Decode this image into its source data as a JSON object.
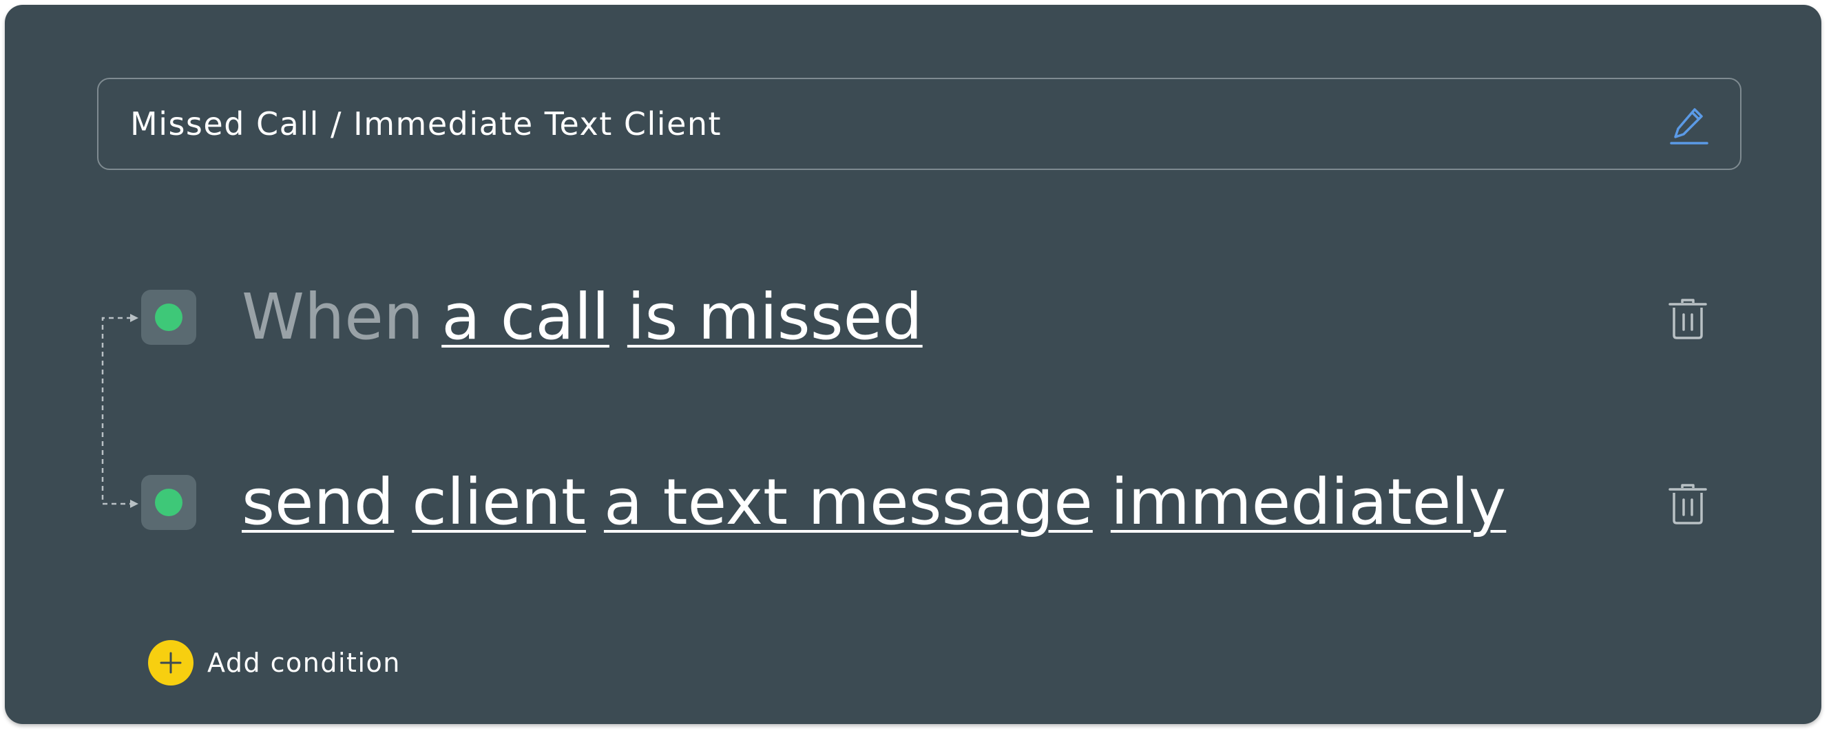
{
  "automation": {
    "name": "Missed Call / Immediate Text Client"
  },
  "icons": {
    "edit": "pencil-icon",
    "delete": "trash-icon",
    "add": "plus-icon",
    "status": "status-dot-icon"
  },
  "colors": {
    "panel_background": "#3c4b53",
    "status_active": "#3ec878",
    "edit_accent": "#5b9ae6",
    "add_button": "#f7cf10",
    "muted_text": "#99a2a7"
  },
  "rules": [
    {
      "keyword": "When",
      "tokens": [
        "a call",
        "is missed"
      ]
    },
    {
      "keyword": "",
      "tokens": [
        "send",
        "client",
        "a text message",
        "immediately"
      ]
    }
  ],
  "add_condition": {
    "label": "Add condition"
  }
}
